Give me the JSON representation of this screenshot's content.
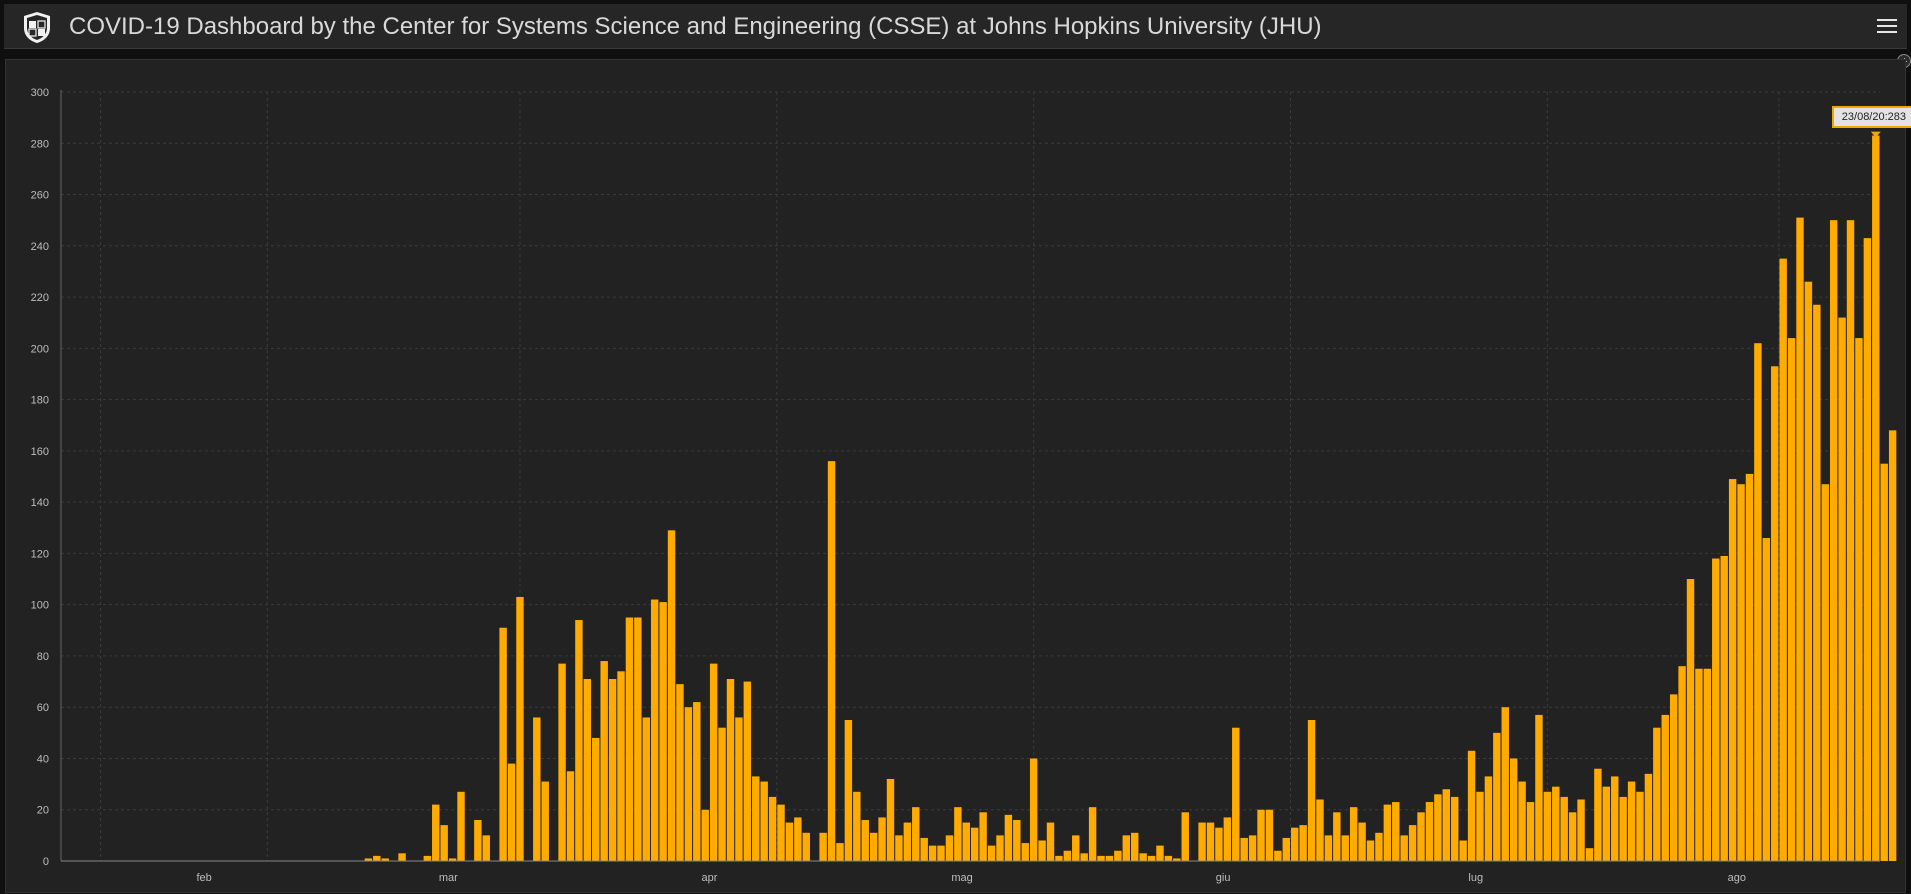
{
  "header": {
    "title": "COVID-19 Dashboard by the Center for Systems Science and Engineering (CSSE) at Johns Hopkins University (JHU)",
    "logo_icon": "jhu-shield-icon",
    "menu_icon": "hamburger-menu-icon"
  },
  "colors": {
    "bar": "#ffab00",
    "background": "#222222",
    "grid": "#3a3a3a",
    "tooltip_border": "#f0a800"
  },
  "tooltip": {
    "text": "23/08/20:283"
  },
  "chart_data": {
    "type": "bar",
    "x_start": "2020-01-22",
    "x_end": "2020-08-24",
    "ylim": [
      0,
      300
    ],
    "y_ticks": [
      0,
      20,
      40,
      60,
      80,
      100,
      120,
      140,
      160,
      180,
      200,
      220,
      240,
      260,
      280,
      300
    ],
    "x_ticks": [
      {
        "label": "feb",
        "date": "2020-02-01"
      },
      {
        "label": "mar",
        "date": "2020-03-01"
      },
      {
        "label": "apr",
        "date": "2020-04-01"
      },
      {
        "label": "mag",
        "date": "2020-05-01"
      },
      {
        "label": "giu",
        "date": "2020-06-01"
      },
      {
        "label": "lug",
        "date": "2020-07-01"
      },
      {
        "label": "ago",
        "date": "2020-08-01"
      }
    ],
    "grid": true,
    "values": [
      0,
      0,
      0,
      0,
      0,
      0,
      0,
      0,
      0,
      0,
      0,
      0,
      0,
      0,
      0,
      0,
      0,
      0,
      0,
      0,
      0,
      0,
      0,
      0,
      0,
      0,
      0,
      0,
      0,
      0,
      0,
      0,
      0,
      0,
      0,
      0,
      1,
      2,
      1,
      0,
      3,
      0,
      0,
      2,
      22,
      14,
      1,
      27,
      0,
      16,
      10,
      0,
      91,
      38,
      103,
      0,
      56,
      31,
      0,
      77,
      35,
      94,
      71,
      48,
      78,
      71,
      74,
      95,
      95,
      56,
      102,
      101,
      129,
      69,
      60,
      62,
      20,
      77,
      52,
      71,
      56,
      70,
      33,
      31,
      25,
      22,
      15,
      17,
      11,
      0,
      11,
      156,
      7,
      55,
      27,
      16,
      11,
      17,
      32,
      10,
      15,
      21,
      9,
      6,
      6,
      10,
      21,
      15,
      13,
      19,
      6,
      10,
      18,
      16,
      7,
      40,
      8,
      15,
      2,
      4,
      10,
      3,
      21,
      2,
      2,
      4,
      10,
      11,
      3,
      2,
      6,
      2,
      1,
      19,
      0,
      15,
      15,
      13,
      17,
      52,
      9,
      10,
      20,
      20,
      4,
      9,
      13,
      14,
      55,
      24,
      10,
      19,
      10,
      21,
      15,
      8,
      11,
      22,
      23,
      10,
      14,
      19,
      23,
      26,
      28,
      25,
      8,
      43,
      27,
      33,
      50,
      60,
      40,
      31,
      23,
      57,
      27,
      29,
      25,
      19,
      24,
      5,
      36,
      29,
      33,
      25,
      31,
      27,
      34,
      52,
      57,
      65,
      76,
      110,
      75,
      75,
      118,
      119,
      149,
      147,
      151,
      202,
      126,
      193,
      235,
      204,
      251,
      226,
      217,
      147,
      250,
      212,
      250,
      204,
      243,
      283,
      155,
      168
    ]
  }
}
